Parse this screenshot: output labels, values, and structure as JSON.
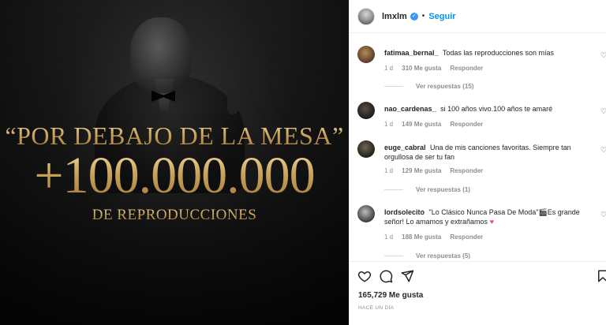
{
  "media": {
    "line1": "“POR DEBAJO DE LA MESA”",
    "line2": "+100.000.000",
    "line3": "DE REPRODUCCIONES",
    "accent_color": "#c9a664"
  },
  "header": {
    "username": "lmxlm",
    "verified_icon": "verified-badge-icon",
    "separator": "•",
    "follow_label": "Seguir",
    "follow_color": "#0095f6"
  },
  "comments": [
    {
      "user": "fatimaa_bernal_",
      "text": "Todas las reproducciones son mías",
      "age": "1 d",
      "likes": "310 Me gusta",
      "reply": "Responder",
      "view_replies": "Ver respuestas (15)"
    },
    {
      "user": "nao_cardenas_",
      "text": "si 100 años vivo.100 años te amaré",
      "age": "1 d",
      "likes": "149 Me gusta",
      "reply": "Responder"
    },
    {
      "user": "euge_cabral",
      "text": "Una de mis canciones favoritas. Siempre tan orgullosa de ser tu fan",
      "age": "1 d",
      "likes": "129 Me gusta",
      "reply": "Responder",
      "view_replies": "Ver respuestas (1)"
    },
    {
      "user": "lordsolecito",
      "text_a": "\"Lo Clásico Nunca Pasa De Moda\"",
      "text_b": "Es grande señor! Lo amamos y extrañamos",
      "age": "1 d",
      "likes": "188 Me gusta",
      "reply": "Responder",
      "view_replies": "Ver respuestas (5)"
    }
  ],
  "footer": {
    "likes_total": "165,729 Me gusta",
    "time_ago": "HACE UN DÍA"
  }
}
